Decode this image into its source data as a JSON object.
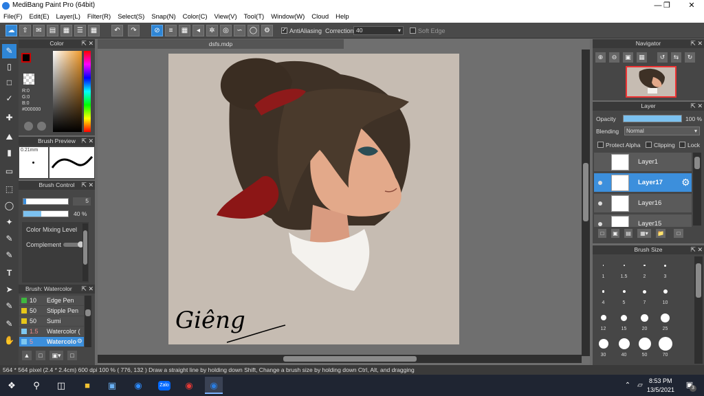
{
  "app": {
    "title": "MediBang Paint Pro (64bit)"
  },
  "menu": [
    "File(F)",
    "Edit(E)",
    "Layer(L)",
    "Filter(R)",
    "Select(S)",
    "Snap(N)",
    "Color(C)",
    "View(V)",
    "Tool(T)",
    "Window(W)",
    "Cloud",
    "Help"
  ],
  "toolbar": {
    "antialiasing_label": "AntiAliasing",
    "correction_label": "Correction",
    "correction_value": "40",
    "soft_edge_label": "Soft Edge"
  },
  "color_panel": {
    "title": "Color",
    "r": "R:0",
    "g": "G:0",
    "b": "B:0",
    "hex": "#000000"
  },
  "brush_preview": {
    "title": "Brush Preview",
    "size": "0.21mm"
  },
  "brush_control": {
    "title": "Brush Control",
    "size_value": "5",
    "opacity_value": "40 %",
    "color_mixing": "Color Mixing Level",
    "complement": "Complement"
  },
  "brush_list": {
    "title": "Brush: Watercolor",
    "items": [
      {
        "size": "10",
        "name": "Edge Pen",
        "color": "#3fb83f"
      },
      {
        "size": "50",
        "name": "Stipple Pen",
        "color": "#e6c619"
      },
      {
        "size": "50",
        "name": "Sumi",
        "color": "#e6c619"
      },
      {
        "size": "1.5",
        "name": "Watercolor (",
        "color": "#7ec8f0"
      },
      {
        "size": "5",
        "name": "Watercolo",
        "color": "#7ec8f0"
      }
    ]
  },
  "document": {
    "tab": "dsfs.mdp",
    "signature": "Giêng"
  },
  "navigator": {
    "title": "Navigator"
  },
  "layer_panel": {
    "title": "Layer",
    "opacity_label": "Opacity",
    "opacity_value": "100 %",
    "opacity_fraction": 1.0,
    "blending_label": "Blending",
    "blending_value": "Normal",
    "protect_alpha": "Protect Alpha",
    "clipping": "Clipping",
    "lock": "Lock",
    "layers": [
      {
        "name": "Layer1"
      },
      {
        "name": "Layer17"
      },
      {
        "name": "Layer16"
      },
      {
        "name": "Layer15"
      }
    ]
  },
  "brush_size": {
    "title": "Brush Size",
    "sizes": [
      "1",
      "1.5",
      "2",
      "3",
      "4",
      "5",
      "7",
      "10",
      "12",
      "15",
      "20",
      "25",
      "30",
      "40",
      "50",
      "70"
    ]
  },
  "status": {
    "text": "564 * 564 pixel   (2.4 * 2.4cm)   600 dpi   100 %   ( 776, 132 )   Draw a straight line by holding down Shift, Change a brush size by holding down Ctrl, Alt, and dragging"
  },
  "taskbar": {
    "time": "8:53 PM",
    "date": "13/5/2021",
    "notif_count": "3",
    "zalo": "Zalo"
  },
  "colors": {
    "accent": "#2f86d6",
    "panel": "#464646",
    "canvas_bg": "#c6bcb2"
  }
}
